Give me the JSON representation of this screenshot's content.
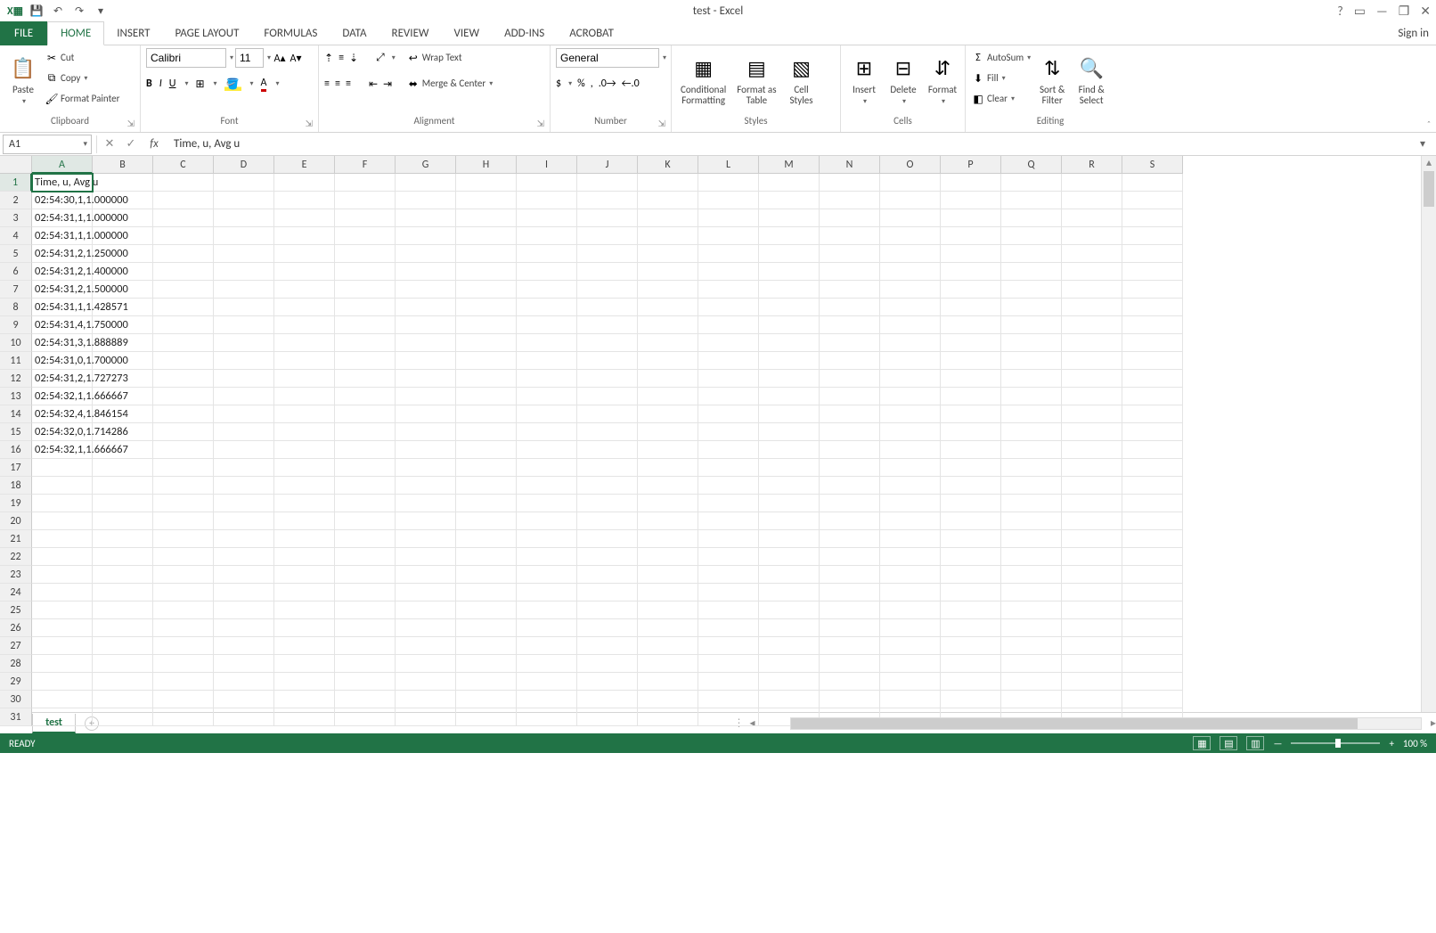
{
  "title": "test - Excel",
  "signin": "Sign in",
  "tabs": {
    "file": "FILE",
    "list": [
      "HOME",
      "INSERT",
      "PAGE LAYOUT",
      "FORMULAS",
      "DATA",
      "REVIEW",
      "VIEW",
      "ADD-INS",
      "ACROBAT"
    ],
    "active_index": 0
  },
  "ribbon": {
    "clipboard": {
      "label": "Clipboard",
      "paste": "Paste",
      "cut": "Cut",
      "copy": "Copy",
      "format_painter": "Format Painter"
    },
    "font": {
      "label": "Font",
      "name": "Calibri",
      "size": "11"
    },
    "alignment": {
      "label": "Alignment",
      "wrap": "Wrap Text",
      "merge": "Merge & Center"
    },
    "number": {
      "label": "Number",
      "format": "General"
    },
    "styles": {
      "label": "Styles",
      "cond": "Conditional\nFormatting",
      "table": "Format as\nTable",
      "cell": "Cell\nStyles"
    },
    "cells": {
      "label": "Cells",
      "insert": "Insert",
      "delete": "Delete",
      "format": "Format"
    },
    "editing": {
      "label": "Editing",
      "autosum": "AutoSum",
      "fill": "Fill",
      "clear": "Clear",
      "sort": "Sort &\nFilter",
      "find": "Find &\nSelect"
    }
  },
  "namebox": "A1",
  "formula": "Time, u, Avg u",
  "columns": [
    "A",
    "B",
    "C",
    "D",
    "E",
    "F",
    "G",
    "H",
    "I",
    "J",
    "K",
    "L",
    "M",
    "N",
    "O",
    "P",
    "Q",
    "R",
    "S"
  ],
  "selected_col": 0,
  "selected_row": 0,
  "row_count": 31,
  "cell_data": [
    "Time, u, Avg u",
    "02:54:30,1,1.000000",
    "02:54:31,1,1.000000",
    "02:54:31,1,1.000000",
    "02:54:31,2,1.250000",
    "02:54:31,2,1.400000",
    "02:54:31,2,1.500000",
    "02:54:31,1,1.428571",
    "02:54:31,4,1.750000",
    "02:54:31,3,1.888889",
    "02:54:31,0,1.700000",
    "02:54:31,2,1.727273",
    "02:54:32,1,1.666667",
    "02:54:32,4,1.846154",
    "02:54:32,0,1.714286",
    "02:54:32,1,1.666667"
  ],
  "sheet": {
    "name": "test"
  },
  "status": {
    "ready": "READY",
    "zoom": "100 %"
  }
}
